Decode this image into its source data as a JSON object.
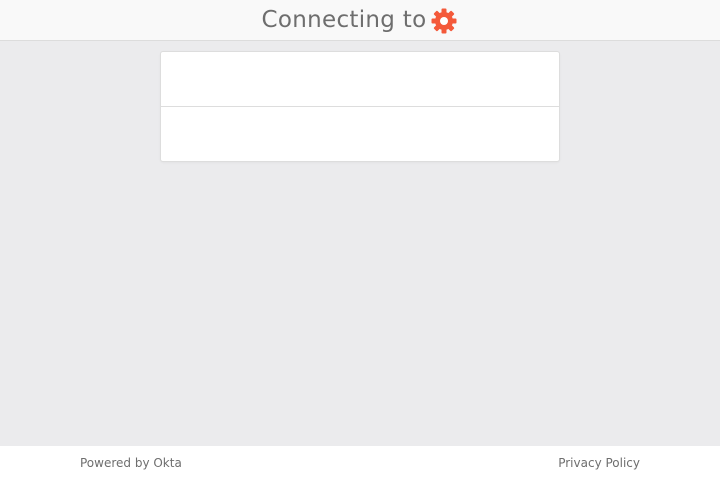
{
  "header": {
    "title": "Connecting to",
    "brand_icon": "gear-icon",
    "brand_color": "#f4593a"
  },
  "footer": {
    "powered_by": "Powered by Okta",
    "privacy_policy": "Privacy Policy"
  }
}
